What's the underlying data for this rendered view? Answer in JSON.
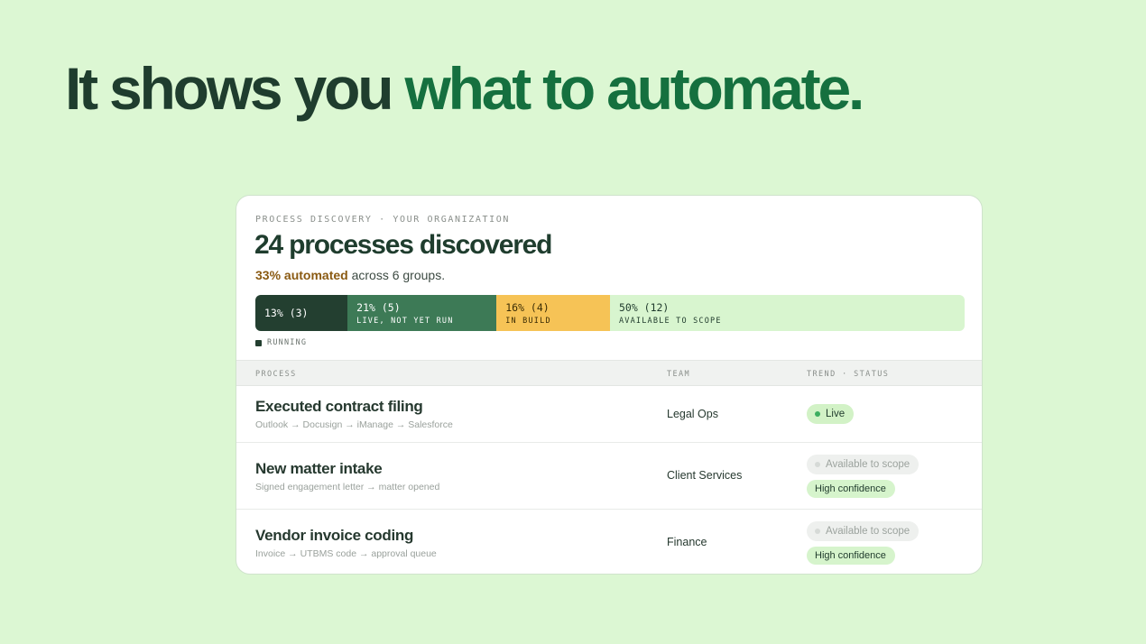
{
  "headline": {
    "part1": "It shows you",
    "part2": "what to automate."
  },
  "card": {
    "eyebrow": "PROCESS DISCOVERY · YOUR ORGANIZATION",
    "title": "24 processes discovered",
    "subtitle_accent": "33% automated",
    "subtitle_rest": " across 6 groups."
  },
  "bar": {
    "segments": [
      {
        "pct": "13% (3)",
        "label": "",
        "share": 13
      },
      {
        "pct": "21% (5)",
        "label": "LIVE, NOT YET RUN",
        "share": 21
      },
      {
        "pct": "16% (4)",
        "label": "IN BUILD",
        "share": 16
      },
      {
        "pct": "50% (12)",
        "label": "AVAILABLE TO SCOPE",
        "share": 50
      }
    ],
    "legend": "RUNNING"
  },
  "table": {
    "headers": [
      "PROCESS",
      "TEAM",
      "TREND · STATUS"
    ],
    "rows": [
      {
        "name": "Executed contract filing",
        "flow": "Outlook → Docusign → iManage → Salesforce",
        "team": "Legal Ops",
        "status": "Live",
        "confidence": ""
      },
      {
        "name": "New matter intake",
        "flow": "Signed engagement letter → matter opened",
        "team": "Client Services",
        "status": "Available to scope",
        "confidence": "High confidence"
      },
      {
        "name": "Vendor invoice coding",
        "flow": "Invoice → UTBMS code → approval queue",
        "team": "Finance",
        "status": "Available to scope",
        "confidence": "High confidence"
      }
    ]
  },
  "colors": {
    "background": "#dcf7d3",
    "running": "#233f30",
    "live": "#3d7a56",
    "build": "#f6c356",
    "available": "#d8f5cf",
    "accent": "#15703f"
  }
}
